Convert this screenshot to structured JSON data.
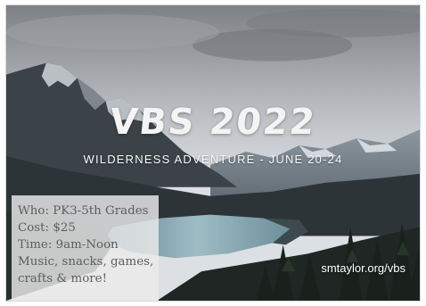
{
  "flyer": {
    "title": "VBS 2022",
    "subtitle": "WILDERNESS ADVENTURE - JUNE 20-24",
    "details": [
      "Who: PK3-5th Grades",
      "Cost: $25",
      "Time: 9am-Noon",
      "Music, snacks, games,",
      "crafts & more!"
    ],
    "url": "smtaylor.org/vbs"
  },
  "colors": {
    "sky_top": "#8a8c90",
    "sky_bottom": "#d9dbdf",
    "mountain_dark": "#2f3538",
    "lake": "#7fa2ad",
    "info_box": "#ebebeb",
    "text_light": "#f4f4f4"
  }
}
